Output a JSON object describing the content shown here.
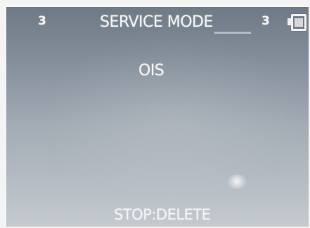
{
  "status_bar": {
    "left_number": "3",
    "title": "SERVICE MODE",
    "right_number": "3",
    "battery_icon": "battery-icon"
  },
  "main": {
    "item_label": "OIS"
  },
  "footer": {
    "instruction": "STOP:DELETE"
  }
}
